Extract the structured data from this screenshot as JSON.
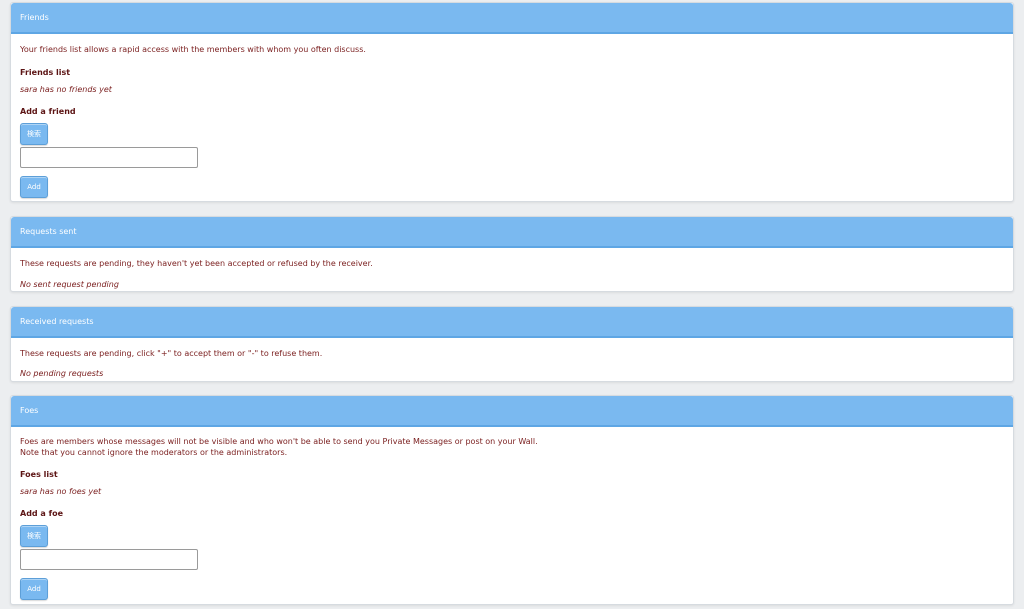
{
  "friends": {
    "title": "Friends",
    "description": "Your friends list allows a rapid access with the members with whom you often discuss.",
    "list_heading": "Friends list",
    "empty_text": "sara has no friends yet",
    "add_heading": "Add a friend",
    "search_label": "検索",
    "input_value": "",
    "add_label": "Add"
  },
  "requests_sent": {
    "title": "Requests sent",
    "description": "These requests are pending, they haven't yet been accepted or refused by the receiver.",
    "empty_text": "No sent request pending"
  },
  "received_requests": {
    "title": "Received requests",
    "description": "These requests are pending, click \"+\" to accept them or \"-\" to refuse them.",
    "empty_text": "No pending requests"
  },
  "foes": {
    "title": "Foes",
    "description_line1": "Foes are members whose messages will not be visible and who won't be able to send you Private Messages or post on your Wall.",
    "description_line2": "Note that you cannot ignore the moderators or the administrators.",
    "list_heading": "Foes list",
    "empty_text": "sara has no foes yet",
    "add_heading": "Add a foe",
    "search_label": "検索",
    "input_value": "",
    "add_label": "Add"
  },
  "colors": {
    "header_blue": "#7ab9f0",
    "text_dark_red": "#7a1e1e",
    "background": "#eceef0"
  }
}
